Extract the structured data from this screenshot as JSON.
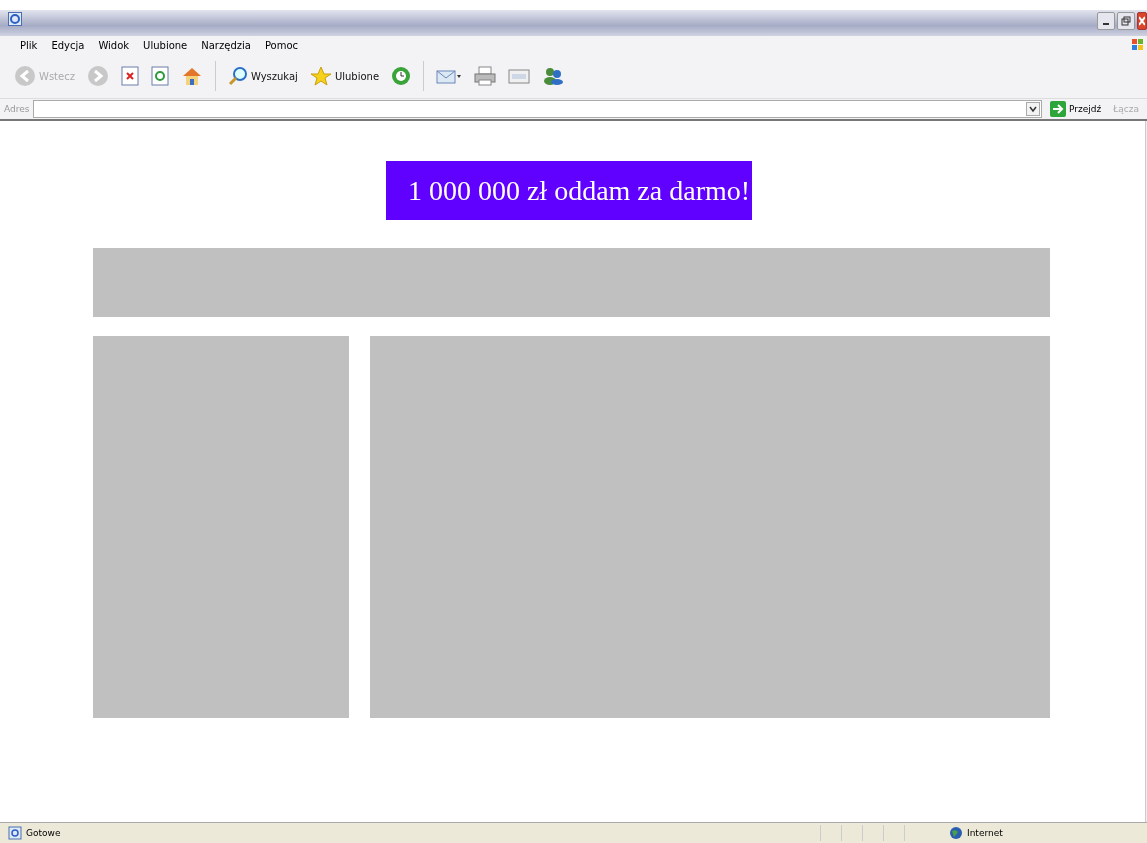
{
  "menu": [
    "Plik",
    "Edycja",
    "Widok",
    "Ulubione",
    "Narzędzia",
    "Pomoc"
  ],
  "toolbar": {
    "back": "Wstecz",
    "search": "Wyszukaj",
    "favorites": "Ulubione"
  },
  "address": {
    "label": "Adres",
    "go": "Przejdź",
    "links": "Łącza"
  },
  "page": {
    "heading": "1 000 000 zł oddam za darmo!"
  },
  "status_bar": {
    "text": "Gotowe",
    "zone": "Internet"
  }
}
